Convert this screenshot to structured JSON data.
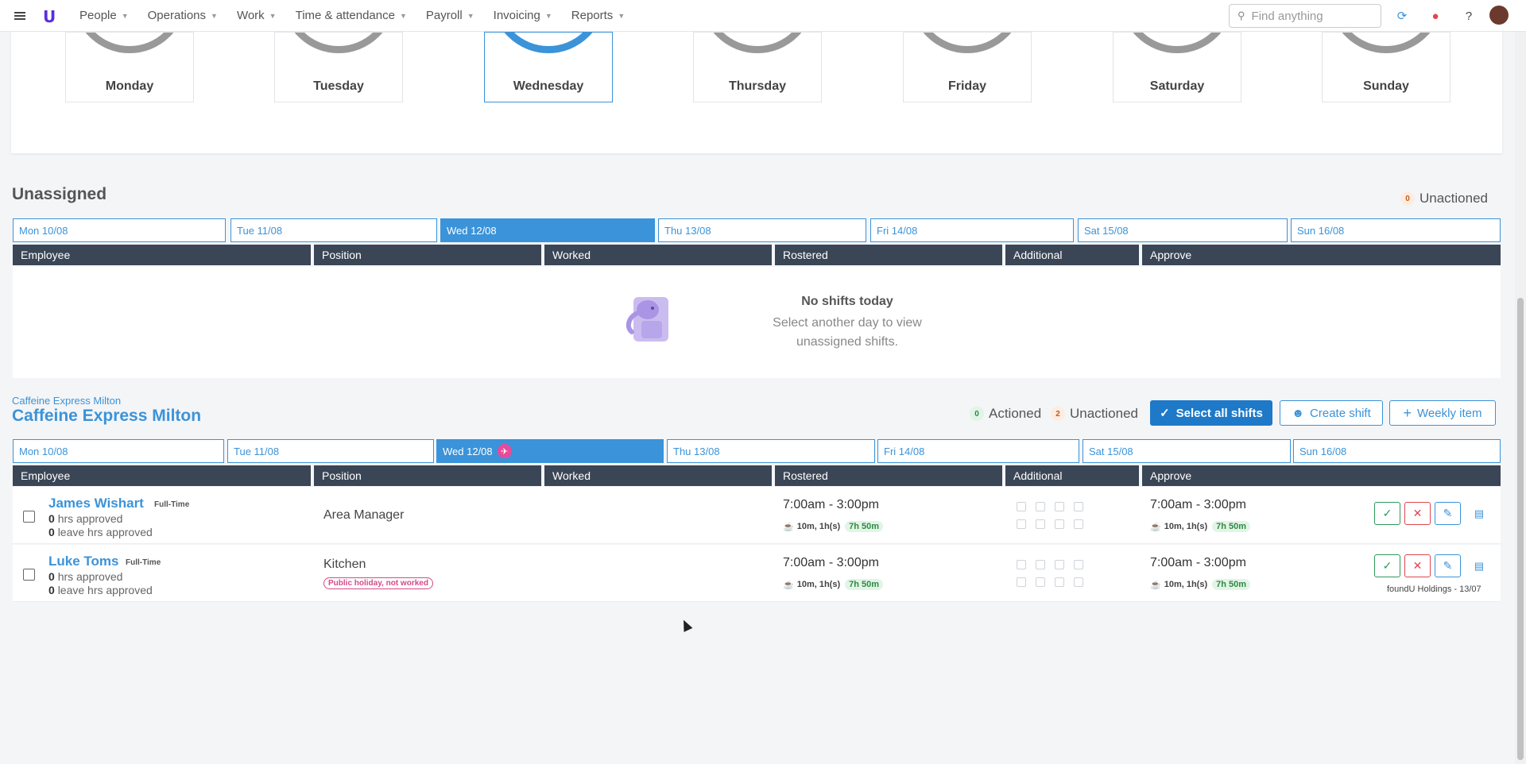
{
  "nav": {
    "items": [
      {
        "label": "People"
      },
      {
        "label": "Operations"
      },
      {
        "label": "Work"
      },
      {
        "label": "Time & attendance"
      },
      {
        "label": "Payroll"
      },
      {
        "label": "Invoicing"
      },
      {
        "label": "Reports"
      }
    ],
    "search_placeholder": "Find anything",
    "icons": [
      "refresh-icon",
      "bell-icon",
      "help-icon"
    ],
    "colors": {
      "refresh": "#3b93d9",
      "bell": "#e0464f"
    }
  },
  "week_days": [
    "Monday",
    "Tuesday",
    "Wednesday",
    "Thursday",
    "Friday",
    "Saturday",
    "Sunday"
  ],
  "active_day_index": 2,
  "unassigned": {
    "title": "Unassigned",
    "unactioned_count": "0",
    "unactioned_label": "Unactioned",
    "tabs": [
      "Mon 10/08",
      "Tue 11/08",
      "Wed 12/08",
      "Thu 13/08",
      "Fri 14/08",
      "Sat 15/08",
      "Sun 16/08"
    ],
    "columns": [
      "Employee",
      "Position",
      "Worked",
      "Rostered",
      "Additional",
      "Approve"
    ],
    "empty_title": "No shifts today",
    "empty_sub_1": "Select another day to view",
    "empty_sub_2": "unassigned shifts."
  },
  "location": {
    "small": "Caffeine Express Milton",
    "title": "Caffeine Express Milton",
    "actioned_count": "0",
    "actioned_label": "Actioned",
    "unactioned_count": "2",
    "unactioned_label": "Unactioned",
    "select_all": "Select all shifts",
    "create_shift": "Create shift",
    "weekly_item": "Weekly item",
    "tabs": [
      "Mon 10/08",
      "Tue 11/08",
      "Wed 12/08",
      "Thu 13/08",
      "Fri 14/08",
      "Sat 15/08",
      "Sun 16/08"
    ],
    "columns": [
      "Employee",
      "Position",
      "Worked",
      "Rostered",
      "Additional",
      "Approve"
    ],
    "rows": [
      {
        "name": "James Wishart",
        "type": "Full-Time",
        "hrs_num": "0",
        "hrs_label": "hrs approved",
        "leave_num": "0",
        "leave_label": "leave hrs approved",
        "position": "Area Manager",
        "tag": "",
        "rostered": "7:00am - 3:00pm",
        "rostered_break": "10m, 1h(s)",
        "rostered_total": "7h 50m",
        "approve": "7:00am - 3:00pm",
        "approve_break": "10m, 1h(s)",
        "approve_total": "7h 50m",
        "note": ""
      },
      {
        "name": "Luke Toms",
        "type": "Full-Time",
        "hrs_num": "0",
        "hrs_label": "hrs approved",
        "leave_num": "0",
        "leave_label": "leave hrs approved",
        "position": "Kitchen",
        "tag": "Public holiday, not worked",
        "rostered": "7:00am - 3:00pm",
        "rostered_break": "10m, 1h(s)",
        "rostered_total": "7h 50m",
        "approve": "7:00am - 3:00pm",
        "approve_break": "10m, 1h(s)",
        "approve_total": "7h 50m",
        "note": "foundU Holdings - 13/07"
      }
    ]
  }
}
